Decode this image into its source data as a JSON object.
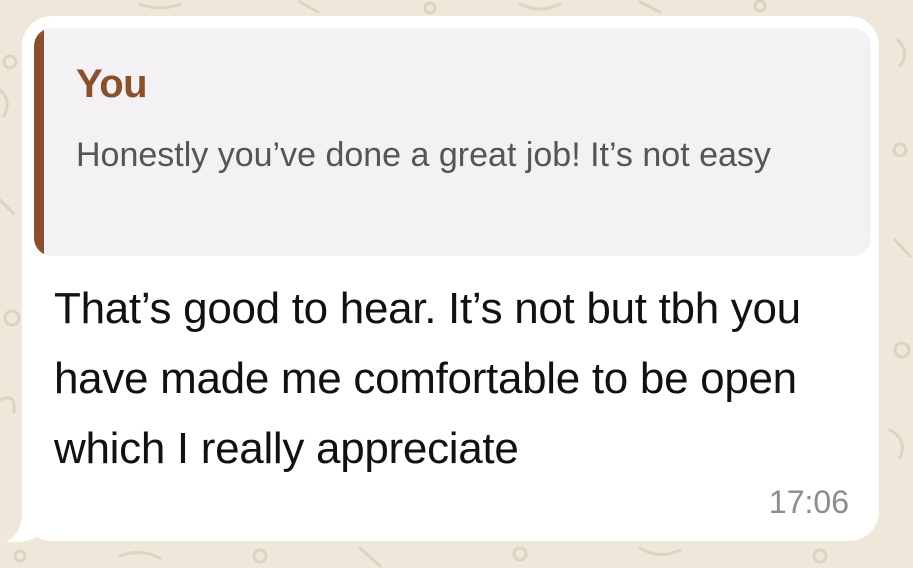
{
  "chat": {
    "wallpaper_color": "#efe7da",
    "bubble_color": "#ffffff"
  },
  "message": {
    "quoted_reply": {
      "author": "You",
      "text": "Honestly you’ve done a great job! It’s not easy",
      "accent_color": "#8a4f2d"
    },
    "body": "That’s good to hear. It’s not but tbh you have made me comfortable to be open which I really appreciate",
    "time": "17:06"
  }
}
